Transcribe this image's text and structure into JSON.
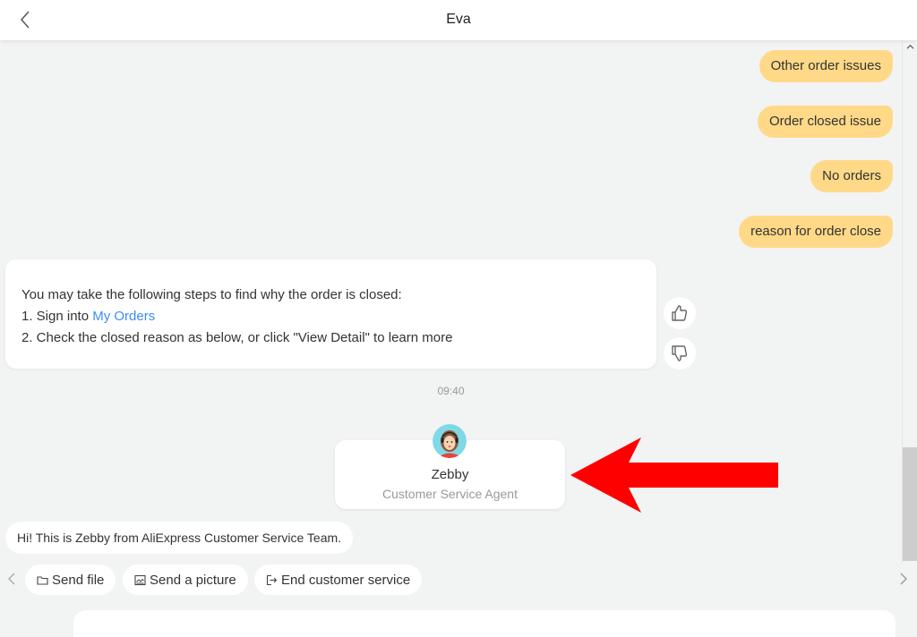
{
  "header": {
    "title": "Eva",
    "back_icon": "chevron-left-icon"
  },
  "messages": {
    "user": [
      "Other order issues",
      "Order closed issue",
      "No orders",
      "reason for order close"
    ],
    "bot_reply": {
      "line1": "You may take the following steps to find why the order is closed:",
      "line2_prefix": "1. Sign into ",
      "line2_link": "My Orders",
      "line3": "2. Check the closed reason as below, or click \"View Detail\" to learn more"
    },
    "feedback": {
      "like_icon": "thumbs-up-icon",
      "dislike_icon": "thumbs-down-icon"
    },
    "timestamp": "09:40",
    "agent": {
      "name": "Zebby",
      "role": "Customer Service Agent"
    },
    "greeting": "Hi! This is Zebby from AliExpress Customer Service Team."
  },
  "quick_actions": [
    {
      "label": "Send file",
      "icon": "folder-icon"
    },
    {
      "label": "Send a picture",
      "icon": "image-icon"
    },
    {
      "label": "End customer service",
      "icon": "exit-icon"
    }
  ],
  "colors": {
    "user_bubble": "#ffd987",
    "link": "#3d8ef6",
    "background": "#f2f3f3",
    "annotation_arrow": "#ff0000"
  },
  "input": {
    "value": "",
    "placeholder": ""
  }
}
